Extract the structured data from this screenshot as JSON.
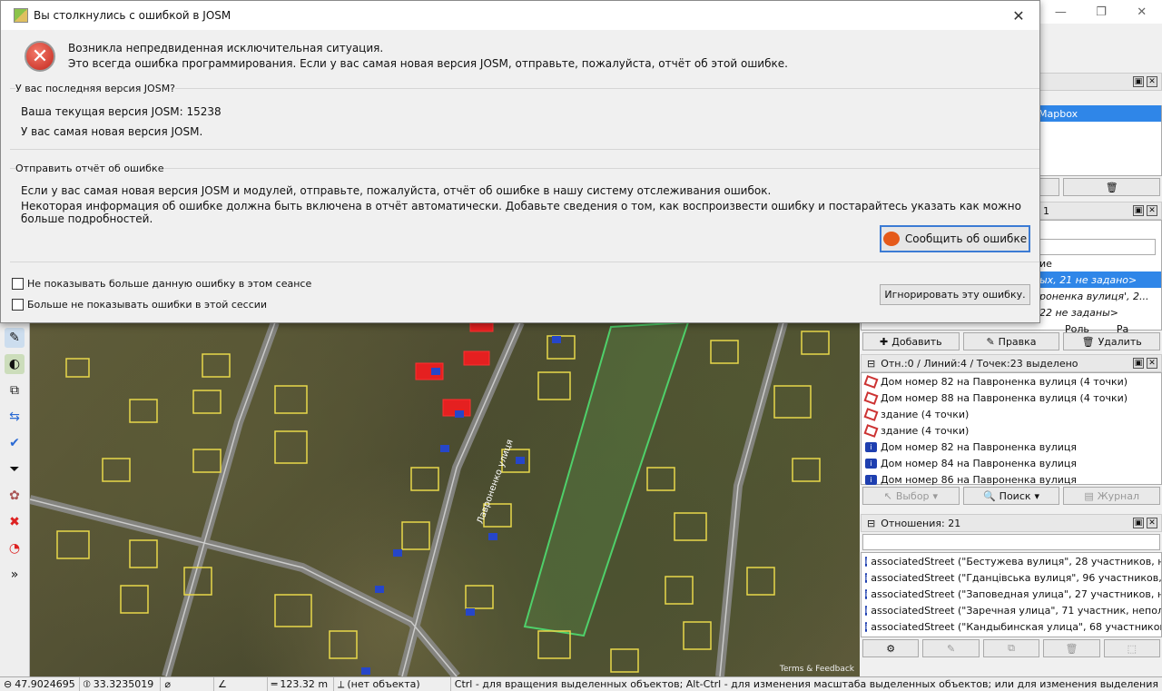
{
  "dialog": {
    "title": "Вы столкнулись с ошибкой в JOSM",
    "error_line1": "Возникла непредвиденная исключительная ситуация.",
    "error_line2": "Это всегда ошибка программирования. Если у вас самая новая версия JOSM, отправьте, пожалуйста, отчёт об этой ошибке.",
    "version_section": "У вас последняя версия JOSM?",
    "current_version": "Ваша текущая версия JOSM: 15238",
    "latest_text": "У вас самая новая версия JOSM.",
    "report_section": "Отправить отчёт об ошибке",
    "report_line1": "Если у вас самая новая версия JOSM и модулей, отправьте, пожалуйста, отчёт об ошибке в нашу систему отслеживания ошибок.",
    "report_line2": "Некоторая информация об ошибке должна быть включена в отчёт автоматически. Добавьте сведения о том, как воспроизвести ошибку и постарайтесь указать как можно больше подробностей.",
    "report_button": "Сообщить об ошибке",
    "checkbox1": "Не показывать больше данную ошибку в этом сеансе",
    "checkbox2": "Больше не показывать ошибки в этой сессии",
    "ignore_button": "Игнорировать эту ошибку."
  },
  "layers_panel": {
    "selected_item": "Mapbox"
  },
  "tags_panel": {
    "title_fragment": "е: 1",
    "rows": [
      "ие",
      "ых, 21 не задано>",
      "роненка вулиця', 2...",
      "22 не заданы>"
    ],
    "col_role": "Роль",
    "col_ra": "Ра",
    "add": "Добавить",
    "edit": "Правка",
    "delete": "Удалить"
  },
  "selection_panel": {
    "title": "Отн.:0 / Линий:4 / Точек:23 выделено",
    "items": [
      {
        "icon": "way",
        "label": "Дом номер 82 на Павроненка вулиця (4 точки)"
      },
      {
        "icon": "way",
        "label": "Дом номер 88 на Павроненка вулиця (4 точки)"
      },
      {
        "icon": "way",
        "label": "здание (4 точки)"
      },
      {
        "icon": "way",
        "label": "здание (4 точки)"
      },
      {
        "icon": "node",
        "label": "Дом номер 82 на Павроненка вулиця"
      },
      {
        "icon": "node",
        "label": "Дом номер 84 на Павроненка вулиця"
      },
      {
        "icon": "node",
        "label": "Дом номер 86 на Павроненка вулиця"
      }
    ],
    "select_btn": "Выбор",
    "search_btn": "Поиск",
    "journal_btn": "Журнал"
  },
  "relations_panel": {
    "title": "Отношения: 21",
    "items": [
      "associatedStreet (\"Бестужева вулиця\", 28 участников, не",
      "associatedStreet (\"Гданцівська вулиця\", 96 участников, н",
      "associatedStreet (\"Заповедная улица\", 27 участников, не",
      "associatedStreet (\"Заречная улица\", 71 участник, непол",
      "associatedStreet (\"Кандыбинская улица\", 68 участников"
    ]
  },
  "map": {
    "terms": "Terms & Feedback",
    "street_label": "Лавроненко улиця"
  },
  "status": {
    "lat": "47.9024695",
    "lon": "33.3235019",
    "distance": "123.32 m",
    "object": "(нет объекта)",
    "hint": "Ctrl - для вращения выделенных объектов; Alt-Ctrl - для изменения масштаба выделенных объектов; или для изменения выделения"
  }
}
